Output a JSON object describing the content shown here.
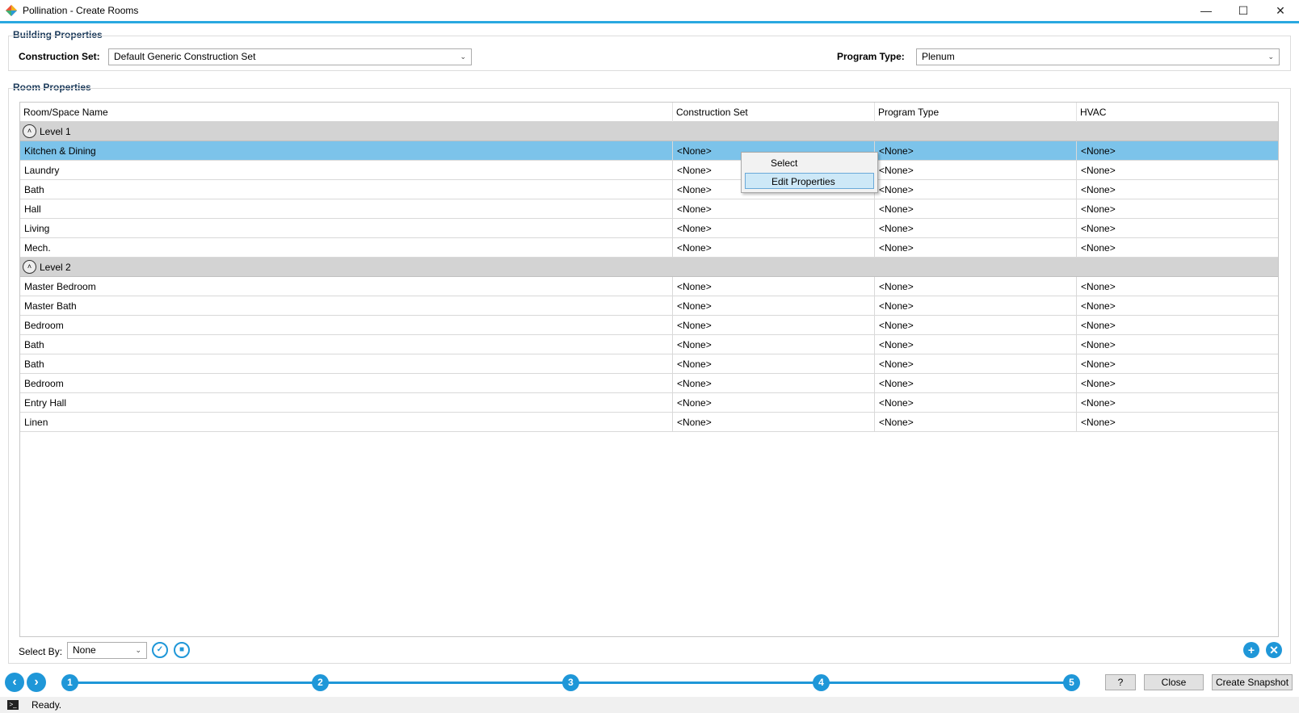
{
  "window": {
    "title": "Pollination - Create Rooms",
    "minimize": "—",
    "maximize": "☐",
    "close": "✕",
    "accent_color": "#29a8e0"
  },
  "building": {
    "group_title": "Building Properties",
    "construction_label": "Construction Set:",
    "construction_value": "Default Generic Construction Set",
    "program_label": "Program Type:",
    "program_value": "Plenum"
  },
  "room": {
    "group_title": "Room Properties",
    "columns": [
      "Room/Space Name",
      "Construction Set",
      "Program Type",
      "HVAC"
    ],
    "groups": [
      {
        "label": "Level 1",
        "rows": [
          [
            "Kitchen & Dining",
            "<None>",
            "<None>",
            "<None>"
          ],
          [
            "Laundry",
            "<None>",
            "<None>",
            "<None>"
          ],
          [
            "Bath",
            "<None>",
            "<None>",
            "<None>"
          ],
          [
            "Hall",
            "<None>",
            "<None>",
            "<None>"
          ],
          [
            "Living",
            "<None>",
            "<None>",
            "<None>"
          ],
          [
            "Mech.",
            "<None>",
            "<None>",
            "<None>"
          ]
        ]
      },
      {
        "label": "Level 2",
        "rows": [
          [
            "Master Bedroom",
            "<None>",
            "<None>",
            "<None>"
          ],
          [
            "Master Bath",
            "<None>",
            "<None>",
            "<None>"
          ],
          [
            "Bedroom",
            "<None>",
            "<None>",
            "<None>"
          ],
          [
            "Bath",
            "<None>",
            "<None>",
            "<None>"
          ],
          [
            "Bath",
            "<None>",
            "<None>",
            "<None>"
          ],
          [
            "Bedroom",
            "<None>",
            "<None>",
            "<None>"
          ],
          [
            "Entry Hall",
            "<None>",
            "<None>",
            "<None>"
          ],
          [
            "Linen",
            "<None>",
            "<None>",
            "<None>"
          ]
        ]
      }
    ],
    "selected_row": "Kitchen & Dining",
    "selection_color": "#7cc3ea"
  },
  "context_menu": {
    "items": [
      "Select",
      "Edit Properties"
    ],
    "highlighted": "Edit Properties"
  },
  "select_by": {
    "label": "Select By:",
    "value": "None"
  },
  "steps": [
    "1",
    "2",
    "3",
    "4",
    "5"
  ],
  "buttons": {
    "help": "?",
    "close": "Close",
    "snapshot": "Create Snapshot"
  },
  "status": {
    "text": "Ready."
  }
}
